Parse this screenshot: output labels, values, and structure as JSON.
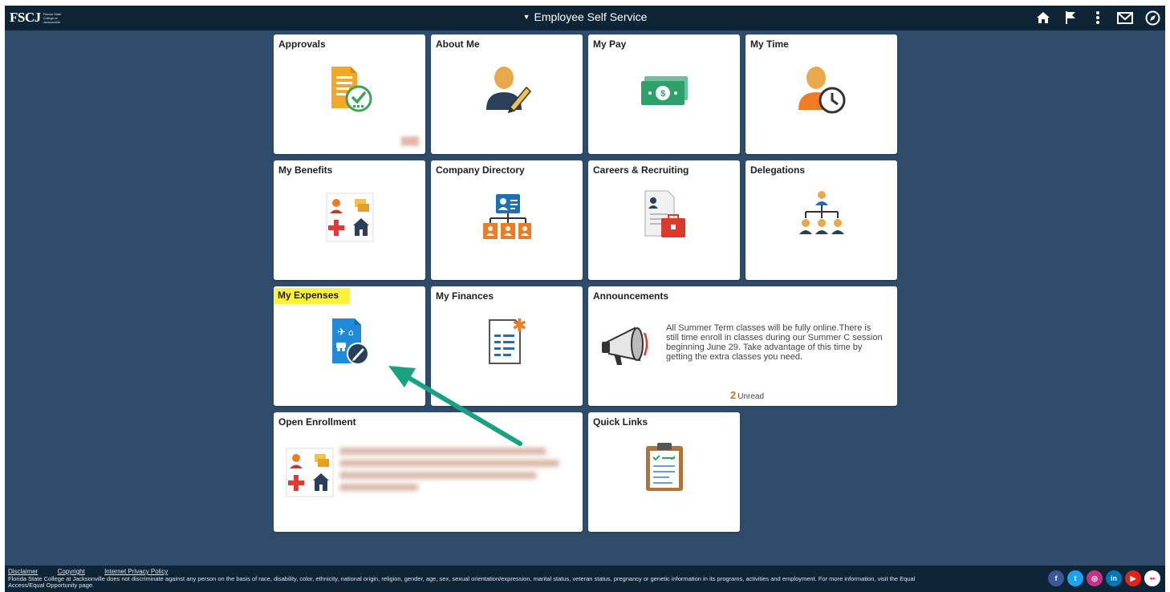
{
  "header": {
    "logo_text": "FSCJ",
    "logo_subtext": "Florida State College at Jacksonville",
    "title": "Employee Self Service",
    "icons": [
      "home-icon",
      "flag-icon",
      "more-vertical-icon",
      "mail-icon",
      "navbar-compass-icon"
    ]
  },
  "tiles": {
    "approvals": "Approvals",
    "about_me": "About Me",
    "my_pay": "My Pay",
    "my_time": "My Time",
    "my_benefits": "My Benefits",
    "company_directory": "Company Directory",
    "careers": "Careers & Recruiting",
    "delegations": "Delegations",
    "my_expenses": "My Expenses",
    "my_finances": "My Finances",
    "announcements": "Announcements",
    "open_enrollment": "Open Enrollment",
    "quick_links": "Quick Links"
  },
  "announcement": {
    "text": "All Summer Term classes will be fully online.There is still time enroll in classes during our Summer C session beginning June 29. Take advantage of this time by getting the extra classes you need.",
    "unread_count": "2",
    "unread_label": "Unread"
  },
  "footer": {
    "links": [
      "Disclaimer",
      "Copyright",
      "Internet Privacy Policy"
    ],
    "notice": "Florida State College at Jacksonville does not discriminate against any person on the basis of race, disability, color, ethnicity, national origin, religion, gender, age, sex, sexual orientation/expression, marital status, veteran status, pregnancy or genetic information in its programs, activities and employment. For more information, visit the Equal Access/Equal Opportunity page.",
    "social": [
      {
        "icon": "facebook-icon",
        "glyph": "f",
        "color": "#3b5998"
      },
      {
        "icon": "twitter-icon",
        "glyph": "t",
        "color": "#1da1f2"
      },
      {
        "icon": "instagram-icon",
        "glyph": "◎",
        "color": "#c13584"
      },
      {
        "icon": "linkedin-icon",
        "glyph": "in",
        "color": "#0077b5"
      },
      {
        "icon": "youtube-icon",
        "glyph": "▶",
        "color": "#e62117"
      },
      {
        "icon": "flickr-icon",
        "glyph": "••",
        "color": "#ffffff"
      }
    ]
  },
  "colors": {
    "background": "#2f4d6b",
    "header": "#0d2537",
    "highlight": "#fff23a",
    "arrow": "#1aa182"
  }
}
